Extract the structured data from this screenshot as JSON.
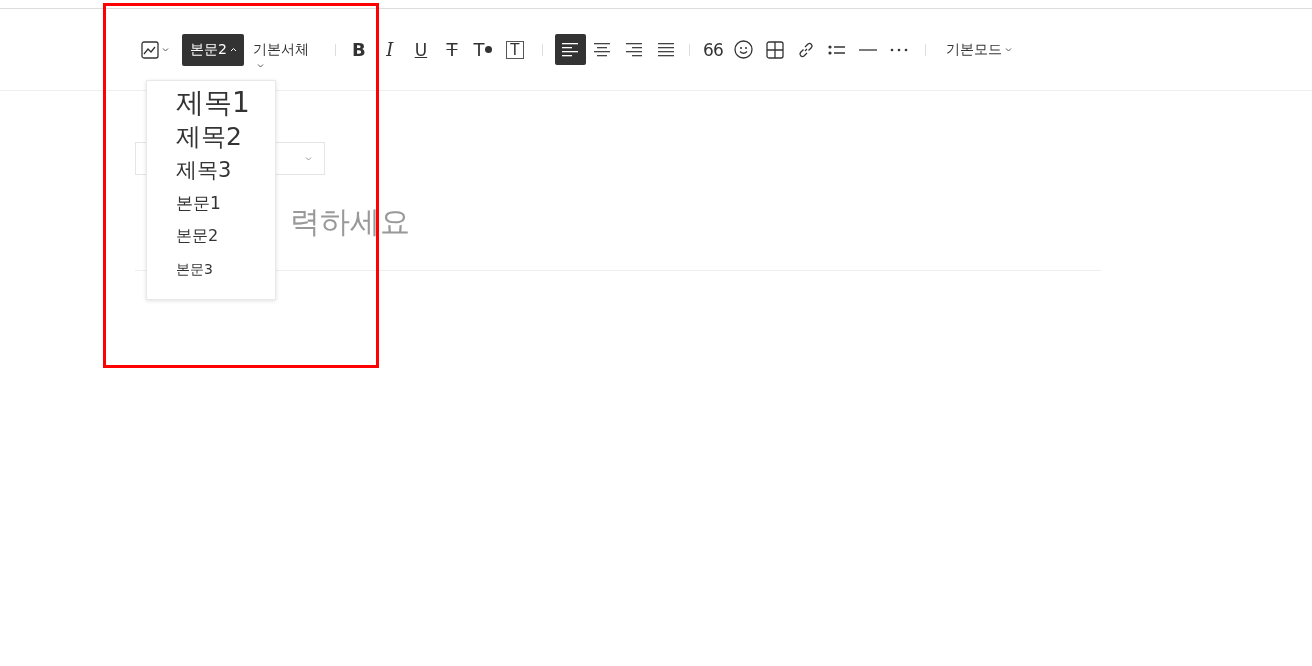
{
  "toolbar": {
    "items": [
      {
        "kind": "image"
      },
      {
        "kind": "style",
        "label": "본문2",
        "expanded": true
      },
      {
        "kind": "font",
        "label": "기본서체"
      },
      {
        "kind": "divider"
      },
      {
        "kind": "bold",
        "label": "B"
      },
      {
        "kind": "italic",
        "label": "I"
      },
      {
        "kind": "underline",
        "label": "U"
      },
      {
        "kind": "strike",
        "label": "T"
      },
      {
        "kind": "color",
        "label": "T"
      },
      {
        "kind": "background",
        "label": "T"
      },
      {
        "kind": "divider"
      },
      {
        "kind": "alignleft",
        "selected": true
      },
      {
        "kind": "aligncenter",
        "selected": false
      },
      {
        "kind": "alignright",
        "selected": false
      },
      {
        "kind": "alignjustify",
        "selected": false
      },
      {
        "kind": "divider"
      },
      {
        "kind": "quote",
        "label": "66"
      },
      {
        "kind": "emoji"
      },
      {
        "kind": "table"
      },
      {
        "kind": "link"
      },
      {
        "kind": "list"
      },
      {
        "kind": "rule"
      },
      {
        "kind": "more"
      },
      {
        "kind": "divider"
      },
      {
        "kind": "mode",
        "label": "기본모드"
      }
    ]
  },
  "style_menu": {
    "items": [
      {
        "kind": "h1",
        "label": "제목1"
      },
      {
        "kind": "h2",
        "label": "제목2"
      },
      {
        "kind": "h3",
        "label": "제목3"
      },
      {
        "kind": "p1",
        "label": "본문1"
      },
      {
        "kind": "p2",
        "label": "본문2"
      },
      {
        "kind": "p3",
        "label": "본문3"
      }
    ]
  },
  "editor": {
    "category_select": {
      "expanded": false
    },
    "title_placeholder_visible": "력하세요"
  },
  "annotation": {
    "kind": "frame",
    "color": "#ff0000"
  }
}
